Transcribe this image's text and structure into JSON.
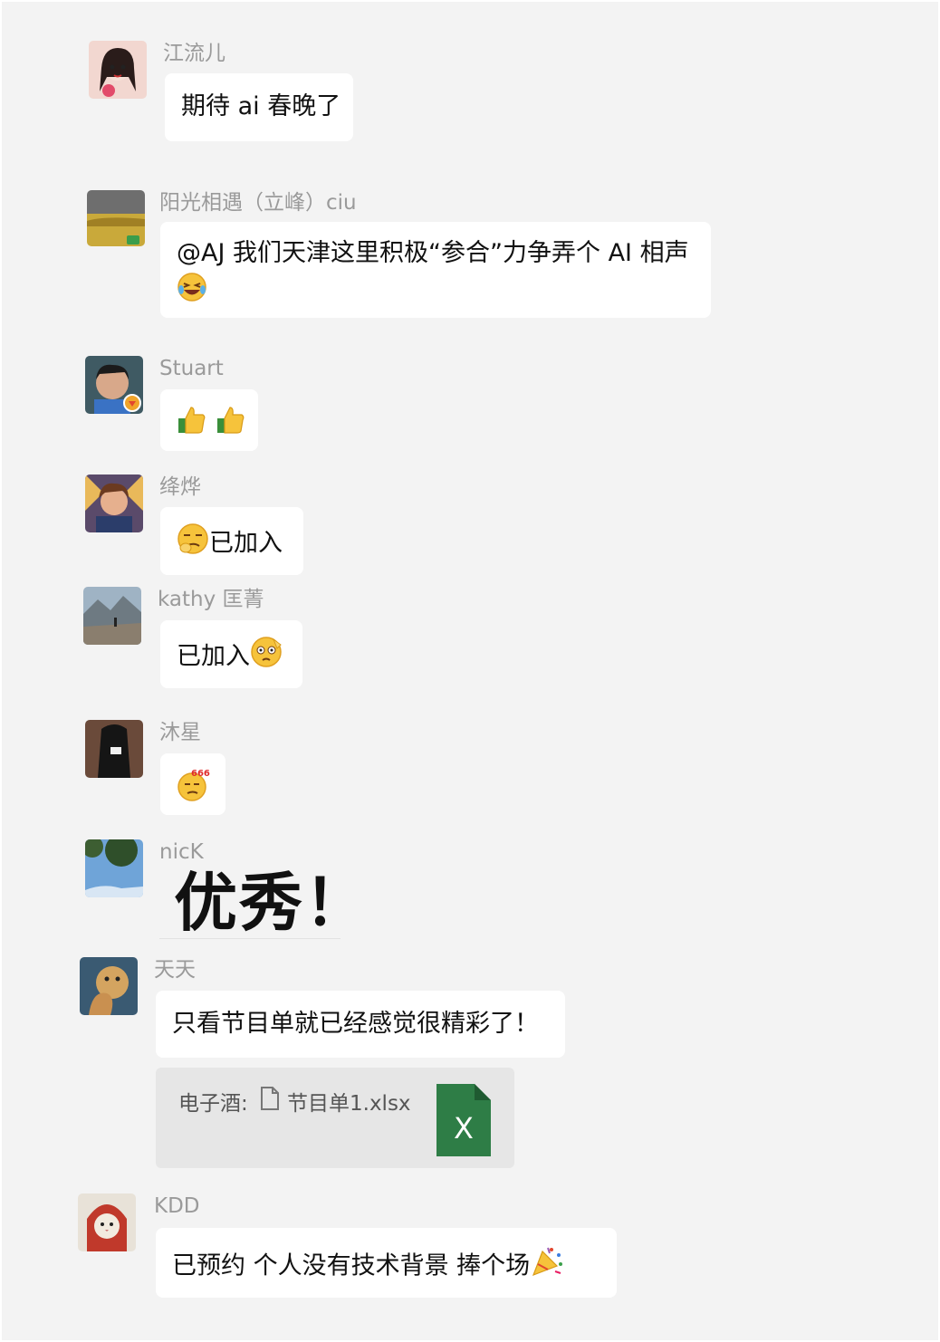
{
  "messages": [
    {
      "sender": "江流儿",
      "text": "期待 ai 春晚了"
    },
    {
      "sender": "阳光相遇（立峰）ciu",
      "text": "@AJ 我们天津这里积极“参合”力争弄个 AI 相声",
      "emoji": "laughing-tears-emoji"
    },
    {
      "sender": "Stuart",
      "emoji": "thumbs-up-emoji x2"
    },
    {
      "sender": "绛烨",
      "text": "已加入",
      "emoji": "smirk-emoji"
    },
    {
      "sender": "kathy 匡菁",
      "text": "已加入",
      "emoji": "salute-emoji"
    },
    {
      "sender": "沐星",
      "emoji": "666-emoji",
      "emoji_label": "666"
    },
    {
      "sender": "nicK",
      "text": "优秀！"
    },
    {
      "sender": "天天",
      "text": "只看节目单就已经感觉很精彩了！",
      "quote": {
        "prefix": "电子酒:",
        "file_name": "节目单1.xlsx",
        "file_icon_letter": "X"
      }
    },
    {
      "sender": "KDD",
      "text": "已预约 个人没有技术背景 捧个场",
      "emoji": "party-popper-emoji"
    }
  ],
  "colors": {
    "background": "#f3f3f3",
    "bubble": "#ffffff",
    "name": "#9a9a9a",
    "excel_green": "#2e7d46"
  }
}
